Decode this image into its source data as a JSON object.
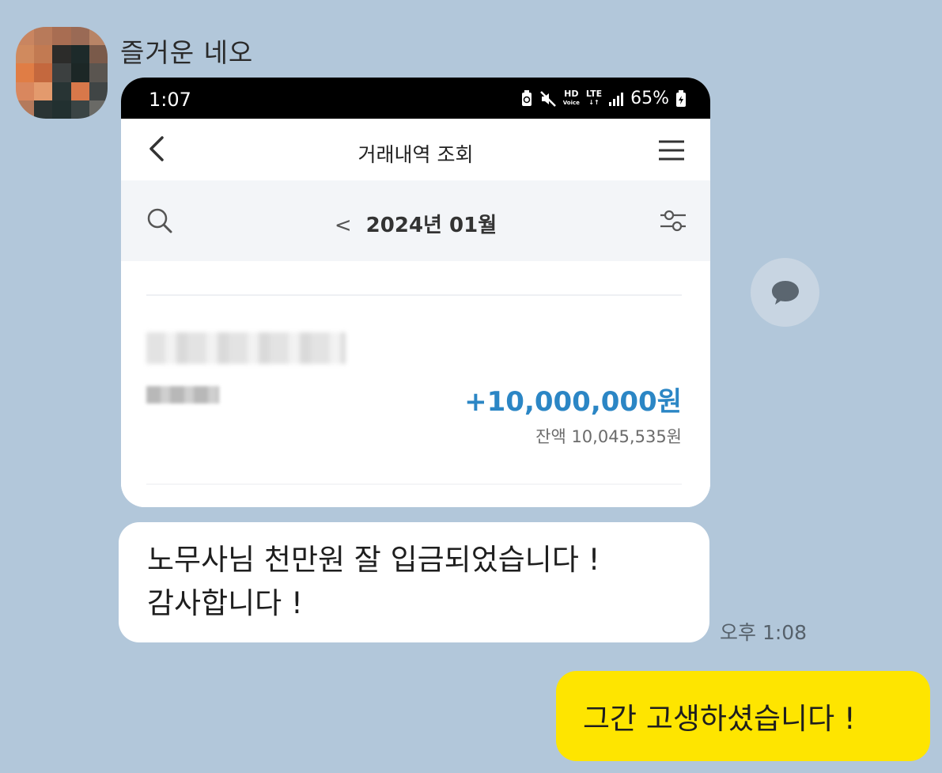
{
  "chat": {
    "sender_name": "즐거운 네오",
    "message_time": "오후 1:08"
  },
  "screenshot": {
    "status_time": "1:07",
    "status_network": "HD",
    "status_network_sub": "Voice",
    "status_lte": "LTE",
    "battery": "65%",
    "title": "거래내역 조회",
    "month_label": "2024년 01월",
    "amount": "+10,000,000원",
    "balance": "잔액 10,045,535원"
  },
  "messages": {
    "received_line1": "노무사님 천만원 잘 입금되었습니다 !",
    "received_line2": "감사합니다 !",
    "sent": "그간 고생하셨습니다 !"
  },
  "colors": {
    "chat_background": "#b2c7da",
    "sent_bubble": "#fee500",
    "amount_text": "#2b86c5"
  },
  "icons": [
    "back-arrow-icon",
    "hamburger-menu-icon",
    "search-icon",
    "filter-settings-icon",
    "speech-bubble-icon"
  ]
}
